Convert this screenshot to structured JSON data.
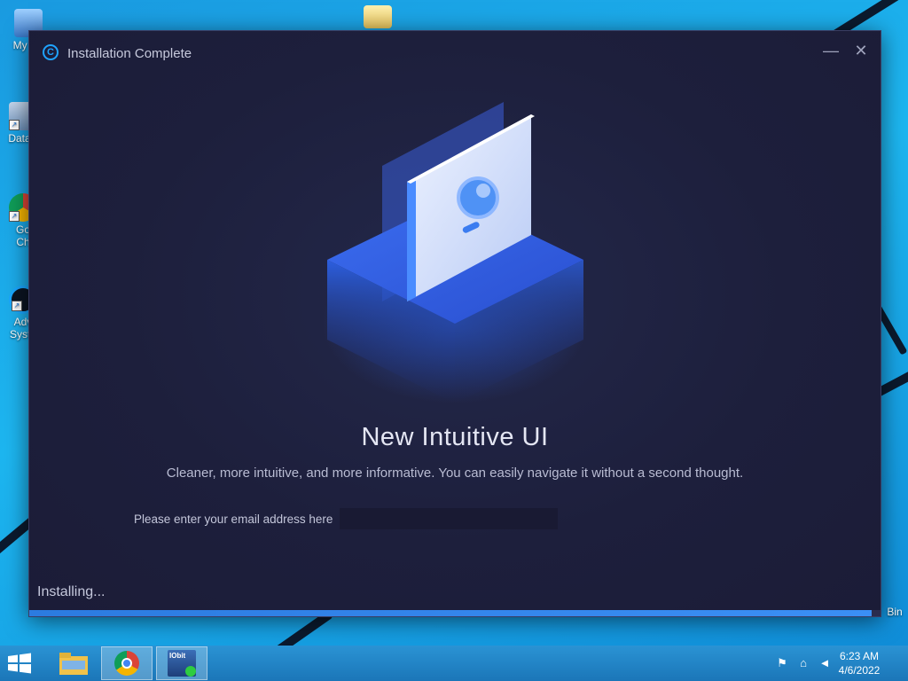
{
  "desktop": {
    "icons": [
      {
        "label": "My Co"
      },
      {
        "label": "DataV"
      },
      {
        "label": "Go Ch"
      },
      {
        "label": "Adv Syste"
      }
    ],
    "recycle_label": "Bin"
  },
  "installer": {
    "title": "Installation Complete",
    "logo_glyph": "C",
    "minimize_glyph": "—",
    "close_glyph": "✕",
    "headline": "New Intuitive UI",
    "subline": "Cleaner, more intuitive, and more informative. You can easily navigate it without a second thought.",
    "email_label": "Please enter your email address here",
    "email_value": "",
    "status": "Installing...",
    "progress": 0.99
  },
  "taskbar": {
    "apps": [
      {
        "name": "file-explorer-icon"
      },
      {
        "name": "chrome-icon"
      },
      {
        "name": "installer-icon",
        "badge": "IObit"
      }
    ],
    "clock_time": "6:23 AM",
    "clock_date": "4/6/2022"
  },
  "colors": {
    "accent": "#1fa3ff",
    "window_bg": "#1d1f3c",
    "taskbar": "#1b76b8"
  }
}
